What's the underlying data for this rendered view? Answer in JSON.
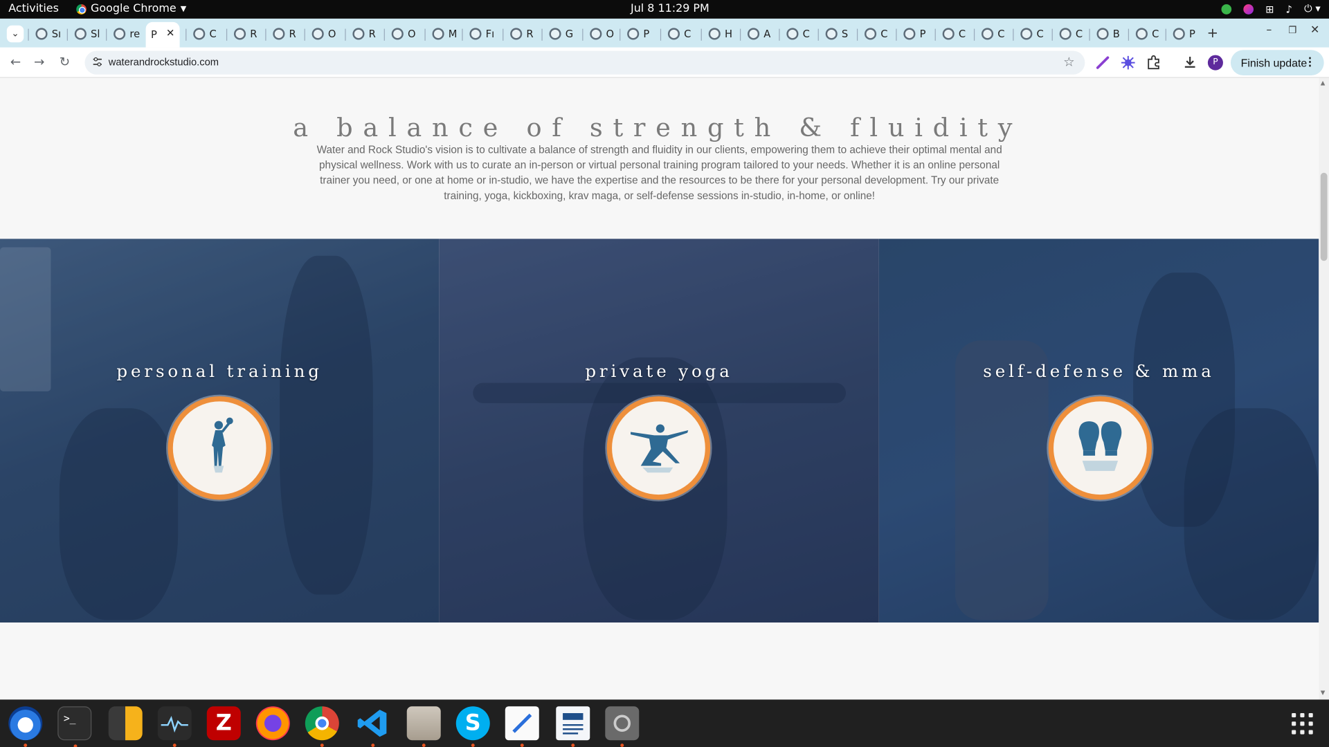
{
  "system": {
    "activities": "Activities",
    "app_name": "Google Chrome",
    "clock": "Jul 8  11:29 PM"
  },
  "tabs": [
    "Sı",
    "Sl",
    "re",
    "P",
    "C",
    "R",
    "R",
    "O",
    "R",
    "O",
    "M",
    "Fı",
    "R",
    "G",
    "O",
    "P",
    "C",
    "H",
    "A",
    "C",
    "S",
    "C",
    "P",
    "C",
    "C",
    "C",
    "C",
    "B",
    "C",
    "P"
  ],
  "browser": {
    "url": "waterandrockstudio.com",
    "finish_update": "Finish update",
    "profile_initial": "P"
  },
  "page": {
    "title": "a balance of strength & fluidity",
    "intro": "Water and Rock Studio's vision is to cultivate a balance of strength and fluidity in our clients, empowering them to achieve their optimal mental and physical wellness. Work with us to curate an in-person or virtual personal training program tailored to your needs. Whether it is an online personal trainer you need, or one at home or in-studio, we have the expertise and the resources to be there for your personal development. Try our private training, yoga, kickboxing, krav maga, or self-defense sessions in-studio, in-home, or online!",
    "services": [
      {
        "label": "personal training",
        "icon": "kettlebell-athlete-icon"
      },
      {
        "label": "private yoga",
        "icon": "yoga-pose-icon"
      },
      {
        "label": "self-defense & mma",
        "icon": "boxing-gloves-icon"
      }
    ]
  },
  "colors": {
    "accent_orange": "#ee8f3b",
    "icon_blue": "#2f6a93",
    "tabstrip": "#cfe9f2"
  },
  "dock": [
    "thunderbird-icon",
    "terminal-icon",
    "calculator-icon",
    "system-monitor-icon",
    "filezilla-icon",
    "firefox-icon",
    "chrome-icon",
    "vscode-icon",
    "files-icon",
    "skype-icon",
    "text-editor-icon",
    "document-viewer-icon",
    "disk-icon",
    "app-grid-icon"
  ]
}
